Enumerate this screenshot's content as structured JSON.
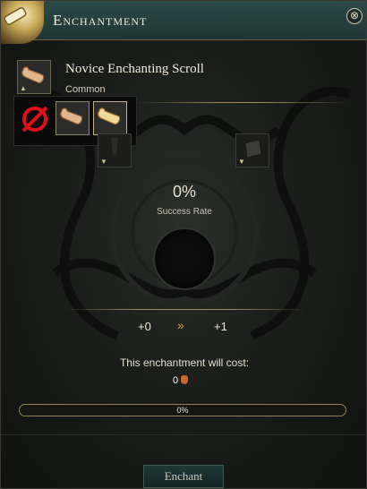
{
  "window": {
    "title": "Enchantment",
    "close_glyph": "⊗"
  },
  "item": {
    "name": "Novice Enchanting Scroll",
    "rarity": "Common",
    "icon": "scroll-icon"
  },
  "scroll_options": [
    {
      "name": "no-scroll-option",
      "icon": "none-icon"
    },
    {
      "name": "novice-scroll-option",
      "icon": "scroll-icon"
    },
    {
      "name": "advanced-scroll-option",
      "icon": "scroll-icon"
    }
  ],
  "materials": {
    "left_icon": "material-icon",
    "right_icon": "stone-icon"
  },
  "success": {
    "value": "0%",
    "label": "Success Rate"
  },
  "levels": {
    "from": "+0",
    "arrow": "»",
    "to": "+1"
  },
  "cost": {
    "label": "This enchantment will cost:",
    "amount": "0",
    "icon": "coin-icon"
  },
  "progress": {
    "percent": 0,
    "text": "0%"
  },
  "buttons": {
    "enchant": "Enchant"
  },
  "colors": {
    "accent_gold": "#9c8b57",
    "title_bar": "#2d4a4a",
    "none_red": "#e0101a"
  }
}
